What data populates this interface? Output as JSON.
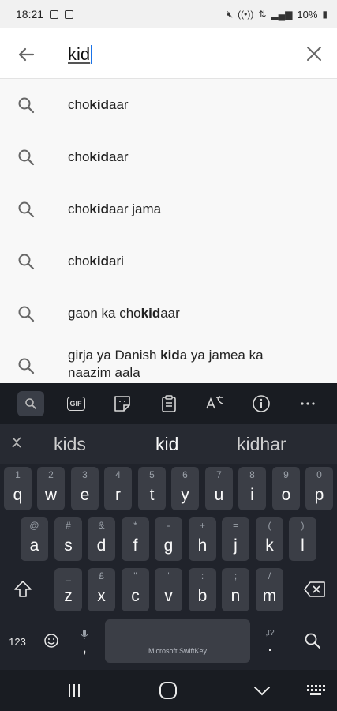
{
  "status_bar": {
    "time": "18:21",
    "battery": "10%"
  },
  "search": {
    "query": "kid"
  },
  "suggestions": [
    {
      "pre": " cho",
      "match": "kid",
      "post": "aar"
    },
    {
      "pre": "cho",
      "match": "kid",
      "post": "aar"
    },
    {
      "pre": "cho",
      "match": "kid",
      "post": "aar jama"
    },
    {
      "pre": "cho",
      "match": "kid",
      "post": "ari"
    },
    {
      "pre": "gaon ka cho",
      "match": "kid",
      "post": "aar"
    },
    {
      "pre": "girja ya Danish  ",
      "match": "kid",
      "post": "a ya jamea ka naazim aala"
    }
  ],
  "keyboard": {
    "toolbar": {
      "gif_label": "GIF"
    },
    "predictions": {
      "left": "kids",
      "center": "kid",
      "right": "kidhar"
    },
    "row1": [
      {
        "m": "q",
        "a": "1"
      },
      {
        "m": "w",
        "a": "2"
      },
      {
        "m": "e",
        "a": "3"
      },
      {
        "m": "r",
        "a": "4"
      },
      {
        "m": "t",
        "a": "5"
      },
      {
        "m": "y",
        "a": "6"
      },
      {
        "m": "u",
        "a": "7"
      },
      {
        "m": "i",
        "a": "8"
      },
      {
        "m": "o",
        "a": "9"
      },
      {
        "m": "p",
        "a": "0"
      }
    ],
    "row2": [
      {
        "m": "a",
        "a": "@"
      },
      {
        "m": "s",
        "a": "#"
      },
      {
        "m": "d",
        "a": "&"
      },
      {
        "m": "f",
        "a": "*"
      },
      {
        "m": "g",
        "a": "-"
      },
      {
        "m": "h",
        "a": "+"
      },
      {
        "m": "j",
        "a": "="
      },
      {
        "m": "k",
        "a": "("
      },
      {
        "m": "l",
        "a": ")"
      }
    ],
    "row3": [
      {
        "m": "z",
        "a": "_"
      },
      {
        "m": "x",
        "a": "£"
      },
      {
        "m": "c",
        "a": "\""
      },
      {
        "m": "v",
        "a": "'"
      },
      {
        "m": "b",
        "a": ":"
      },
      {
        "m": "n",
        "a": ";"
      },
      {
        "m": "m",
        "a": "/"
      }
    ],
    "numbers_label": "123",
    "comma_label": ",",
    "period_label": ".",
    "period_alt": ",!?",
    "space_label": "Microsoft SwiftKey"
  },
  "colors": {
    "keyboard_bg": "#20232b",
    "key_bg": "#3b3e46",
    "caret": "#1a73e8"
  }
}
